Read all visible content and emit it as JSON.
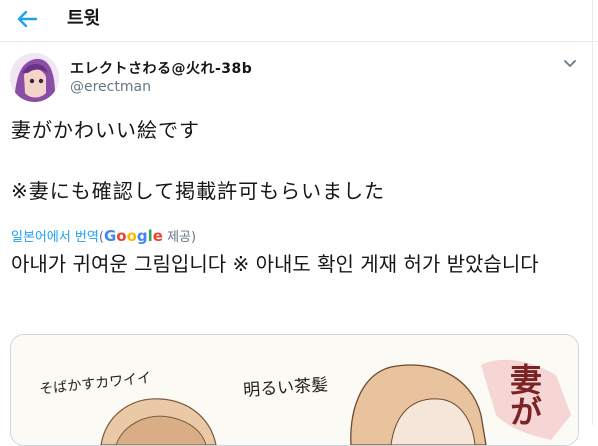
{
  "header": {
    "title": "트윗",
    "back_icon": "arrow-left-icon"
  },
  "tweet": {
    "display_name": "エレクトさわる@火れ-38b",
    "handle": "@erectman",
    "text_line1": "妻がかわいい絵です",
    "text_line2": "※妻にも確認して掲載許可もらいました",
    "translation_link": "일본어에서 번역",
    "translation_paren_open": "(",
    "translation_provider": "Google",
    "translation_suffix": " 제공)",
    "translated_text": "아내가 귀여운 그림입니다 ※ 아내도 확인 게재 허가 받았습니다"
  },
  "image_text": {
    "left": "そばかすカワイイ",
    "center": "明るい茶髪",
    "right": "妻が"
  },
  "colors": {
    "accent": "#1da1f2",
    "secondary_text": "#657786",
    "border": "#e6ecf0"
  }
}
